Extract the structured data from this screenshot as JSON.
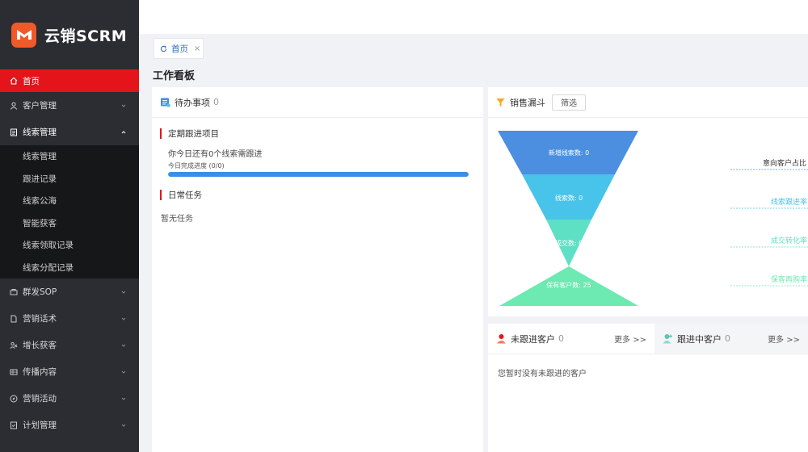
{
  "app": {
    "name": "云销SCRM"
  },
  "sidebar": {
    "items": [
      {
        "label": "首页"
      },
      {
        "label": "客户管理"
      },
      {
        "label": "线索管理"
      },
      {
        "label": "群发SOP"
      },
      {
        "label": "营销话术"
      },
      {
        "label": "增长获客"
      },
      {
        "label": "传播内容"
      },
      {
        "label": "营销活动"
      },
      {
        "label": "计划管理"
      }
    ],
    "submenu": [
      "线索管理",
      "跟进记录",
      "线索公海",
      "智能获客",
      "线索领取记录",
      "线索分配记录"
    ]
  },
  "tabs": [
    {
      "label": "首页",
      "close": "×"
    }
  ],
  "page_title": "工作看板",
  "todo": {
    "title": "待办事项",
    "count": "0",
    "section1": "定期跟进项目",
    "line1": "你今日还有0个线索需跟进",
    "progress_label": "今日完成进度 (0/0)",
    "progress": 1.0,
    "section2": "日常任务",
    "empty": "暂无任务"
  },
  "funnel": {
    "title": "销售漏斗",
    "filter_label": "筛选",
    "stages": [
      {
        "label": "新增线索数: 0",
        "color": "#4c8fe0"
      },
      {
        "label": "线索数: 0",
        "color": "#48c3e9"
      },
      {
        "label": "成交数: 0",
        "color": "#5ee0c4"
      },
      {
        "label": "保有客户数: 25",
        "color": "#6de9b2"
      }
    ],
    "ratios": [
      {
        "label": "意向客户占比",
        "color": "#333333"
      },
      {
        "label": "线索跟进率",
        "color": "#48c3e9"
      },
      {
        "label": "成交转化率",
        "color": "#5ee0c4"
      },
      {
        "label": "保客再购率",
        "color": "#6de9b2"
      }
    ]
  },
  "customers": {
    "tab1": {
      "title": "未跟进客户",
      "count": "0",
      "more": "更多 >>"
    },
    "tab2": {
      "title": "跟进中客户",
      "count": "0",
      "more": "更多 >>"
    },
    "empty": "您暂时没有未跟进的客户"
  },
  "colors": {
    "accent": "#e3151a",
    "sidebar": "#2b2d33",
    "submenu": "#161719",
    "progress": "#3a8ee6"
  }
}
